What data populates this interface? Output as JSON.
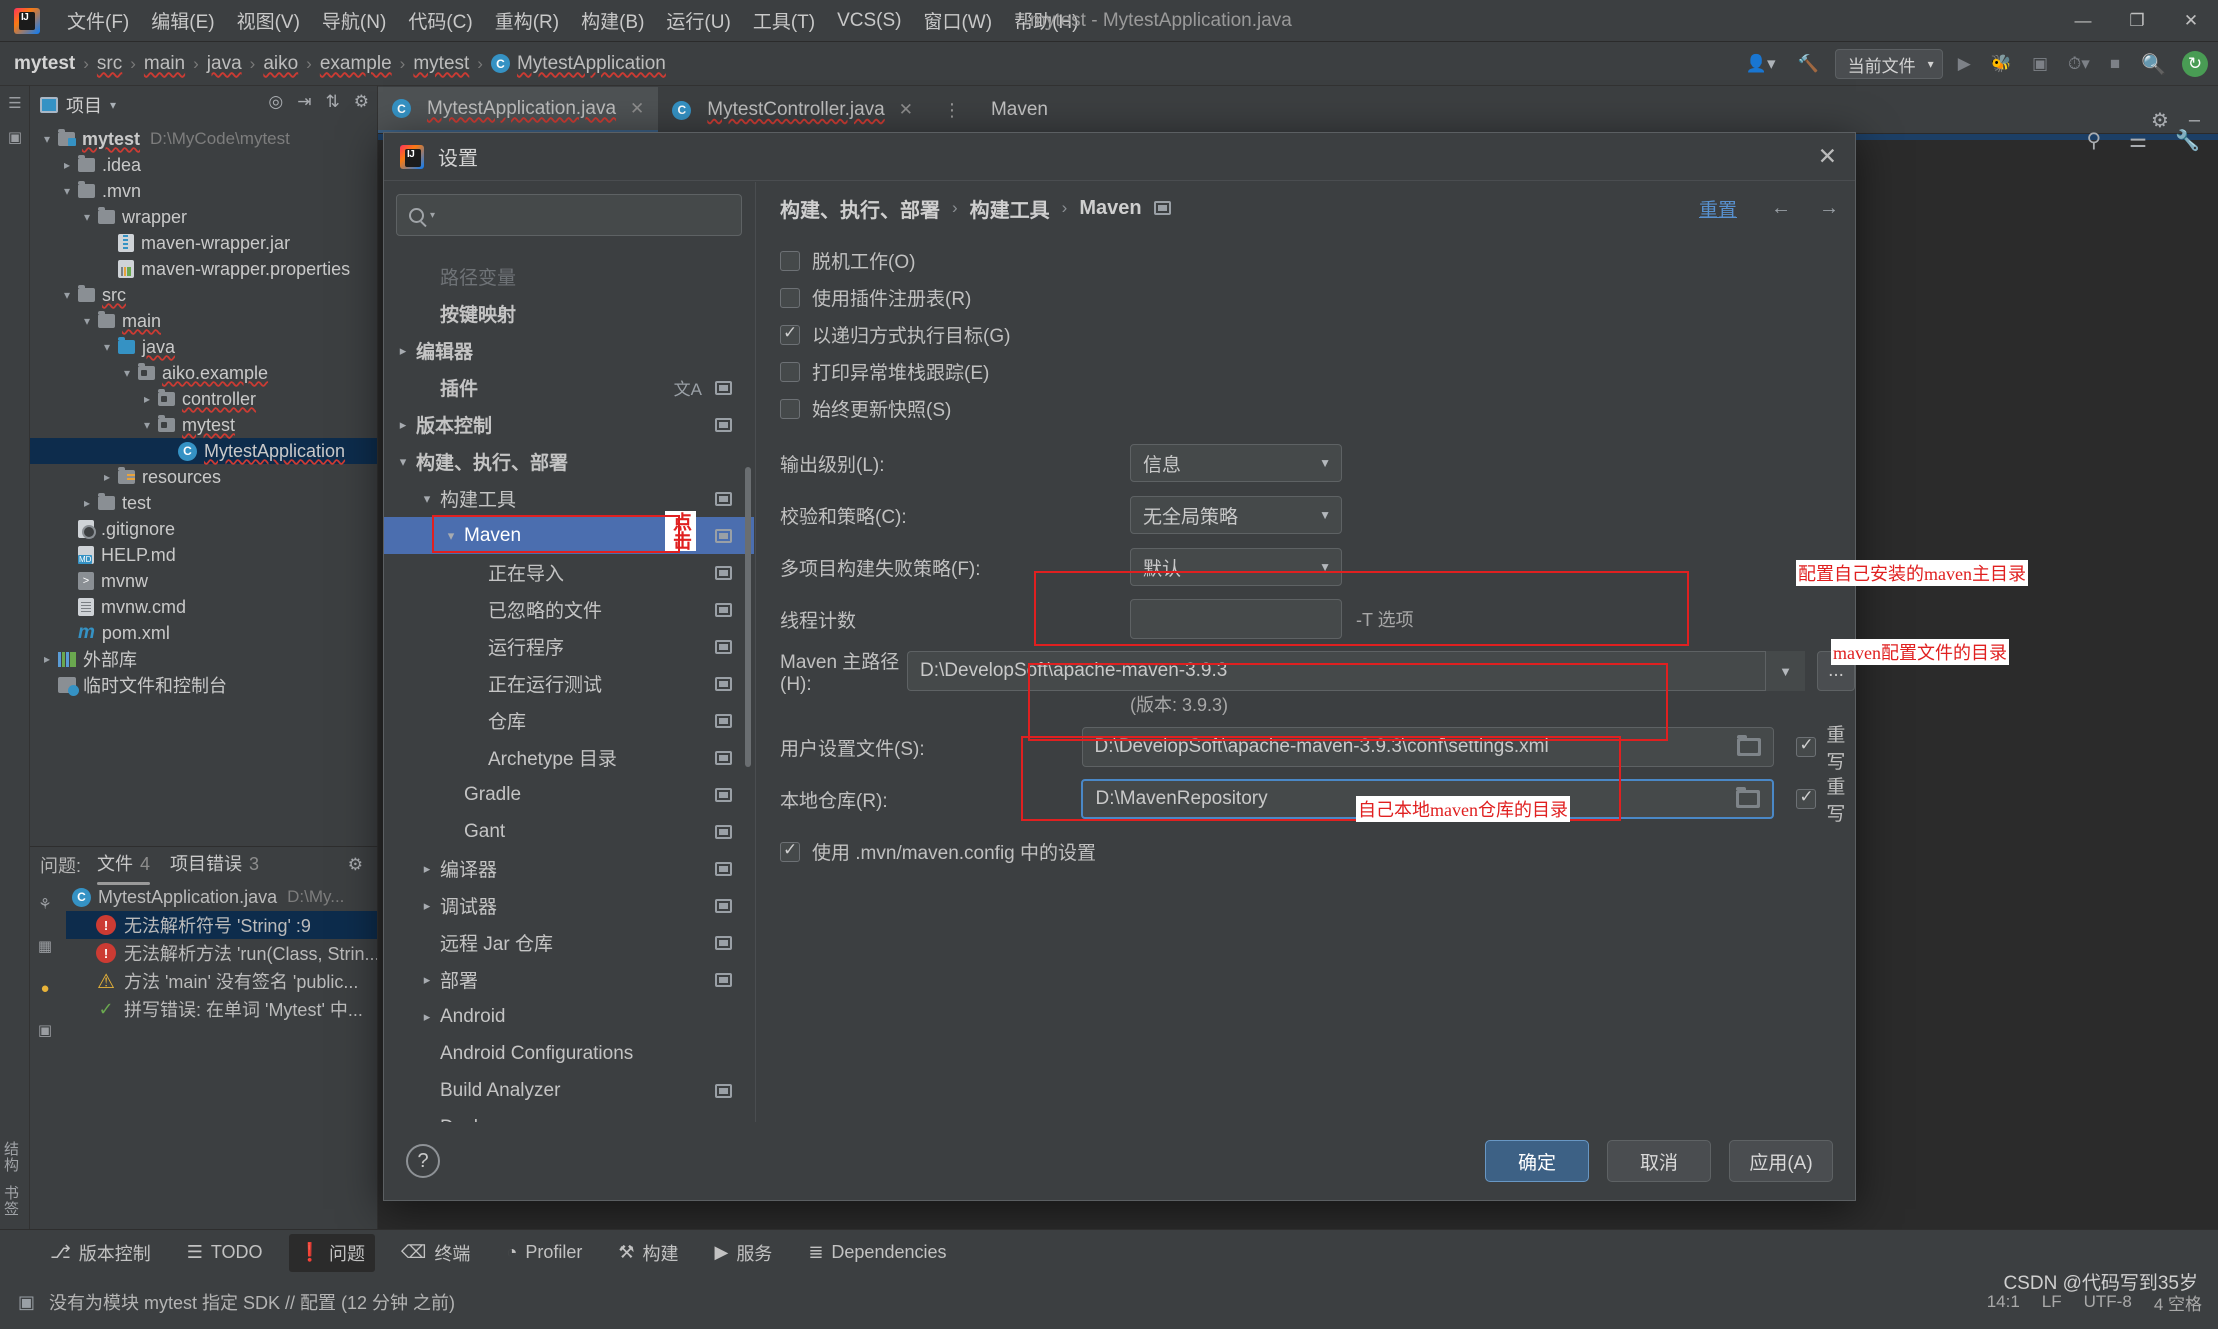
{
  "window": {
    "title": "mytest - MytestApplication.java",
    "menus": [
      "文件(F)",
      "编辑(E)",
      "视图(V)",
      "导航(N)",
      "代码(C)",
      "重构(R)",
      "构建(B)",
      "运行(U)",
      "工具(T)",
      "VCS(S)",
      "窗口(W)",
      "帮助(H)"
    ],
    "controls": {
      "minimize": "—",
      "maximize": "❐",
      "close": "✕"
    }
  },
  "navbar": {
    "crumbs": [
      "mytest",
      "src",
      "main",
      "java",
      "aiko",
      "example",
      "mytest",
      "MytestApplication"
    ],
    "separator": "›",
    "run_config": "当前文件",
    "icons": [
      "user-icon",
      "hammer-icon",
      "run-icon",
      "debug-icon",
      "coverage-icon",
      "profile-icon",
      "stop-icon",
      "search-icon",
      "update-icon"
    ]
  },
  "project_panel": {
    "title": "项目",
    "tools": [
      "collapse-icon",
      "locate-icon",
      "sort-icon",
      "settings-icon"
    ],
    "tree": [
      {
        "depth": 0,
        "arrow": "v",
        "icon": "folder-flag",
        "label": "mytest",
        "bold": true,
        "squig": true,
        "path": "D:\\MyCode\\mytest"
      },
      {
        "depth": 1,
        "arrow": ">",
        "icon": "folder",
        "label": ".idea"
      },
      {
        "depth": 1,
        "arrow": "v",
        "icon": "folder",
        "label": ".mvn"
      },
      {
        "depth": 2,
        "arrow": "v",
        "icon": "folder",
        "label": "wrapper"
      },
      {
        "depth": 3,
        "arrow": "",
        "icon": "zip",
        "label": "maven-wrapper.jar"
      },
      {
        "depth": 3,
        "arrow": "",
        "icon": "prop",
        "label": "maven-wrapper.properties"
      },
      {
        "depth": 1,
        "arrow": "v",
        "icon": "folder",
        "label": "src",
        "squig": true
      },
      {
        "depth": 2,
        "arrow": "v",
        "icon": "folder",
        "label": "main",
        "squig": true
      },
      {
        "depth": 3,
        "arrow": "v",
        "icon": "folder-blue",
        "label": "java",
        "squig": true
      },
      {
        "depth": 4,
        "arrow": "v",
        "icon": "folder-pkg",
        "label": "aiko.example",
        "squig": true
      },
      {
        "depth": 5,
        "arrow": ">",
        "icon": "folder-pkg",
        "label": "controller",
        "squig": true
      },
      {
        "depth": 5,
        "arrow": "v",
        "icon": "folder-pkg",
        "label": "mytest",
        "squig": true
      },
      {
        "depth": 6,
        "arrow": "",
        "icon": "class",
        "label": "MytestApplication",
        "squig": true,
        "selected": true
      },
      {
        "depth": 3,
        "arrow": ">",
        "icon": "folder-res",
        "label": "resources"
      },
      {
        "depth": 2,
        "arrow": ">",
        "icon": "folder",
        "label": "test"
      },
      {
        "depth": 1,
        "arrow": "",
        "icon": "git",
        "label": ".gitignore"
      },
      {
        "depth": 1,
        "arrow": "",
        "icon": "md",
        "label": "HELP.md"
      },
      {
        "depth": 1,
        "arrow": "",
        "icon": "sh",
        "label": "mvnw"
      },
      {
        "depth": 1,
        "arrow": "",
        "icon": "cmd",
        "label": "mvnw.cmd"
      },
      {
        "depth": 1,
        "arrow": "",
        "icon": "maven",
        "label": "pom.xml"
      },
      {
        "depth": 0,
        "arrow": ">",
        "icon": "lib",
        "label": "外部库"
      },
      {
        "depth": 0,
        "arrow": "",
        "icon": "scratch",
        "label": "临时文件和控制台"
      }
    ]
  },
  "problems": {
    "label": "问题:",
    "tabs": [
      {
        "label": "文件",
        "count": "4",
        "active": true
      },
      {
        "label": "项目错误",
        "count": "3",
        "active": false
      }
    ],
    "file": {
      "name": "MytestApplication.java",
      "path": "D:\\My..."
    },
    "rows": [
      {
        "severity": "err",
        "text": "无法解析符号 'String' :9",
        "selected": true
      },
      {
        "severity": "err",
        "text": "无法解析方法 'run(Class, Strin..."
      },
      {
        "severity": "warn",
        "text": "方法 'main' 没有签名 'public..."
      },
      {
        "severity": "ok",
        "text": "拼写错误: 在单词 'Mytest' 中..."
      }
    ],
    "rail_icons": [
      "inspect-icon",
      "grid-icon",
      "bulb-icon",
      "layout-icon"
    ]
  },
  "editor": {
    "tabs": [
      {
        "label": "MytestApplication.java",
        "icon": "class-icon",
        "active": true,
        "close": "✕"
      },
      {
        "label": "MytestController.java",
        "icon": "class-icon",
        "active": false,
        "close": "✕"
      }
    ],
    "tab_menu": "⋮",
    "toolwindow_label": "Maven",
    "right_icons": [
      "settings-icon",
      "minimize-icon"
    ],
    "side_icons": [
      "bookmark-icon",
      "structure-icon",
      "wrench-icon"
    ]
  },
  "dialog": {
    "title": "设置",
    "close": "✕",
    "search_placeholder": "",
    "search_icon": "search-icon",
    "tree": [
      {
        "depth": 1,
        "arrow": "",
        "label": "路径变量",
        "faded": true
      },
      {
        "depth": 1,
        "arrow": "",
        "label": "按键映射",
        "bold": true
      },
      {
        "depth": 0,
        "arrow": ">",
        "label": "编辑器",
        "bold": true
      },
      {
        "depth": 1,
        "arrow": "",
        "label": "插件",
        "bold": true,
        "badge": true,
        "xlate": "文A"
      },
      {
        "depth": 0,
        "arrow": ">",
        "label": "版本控制",
        "bold": true,
        "badge": true
      },
      {
        "depth": 0,
        "arrow": "v",
        "label": "构建、执行、部署",
        "bold": true
      },
      {
        "depth": 1,
        "arrow": "v",
        "label": "构建工具",
        "badge": true
      },
      {
        "depth": 2,
        "arrow": "v",
        "label": "Maven",
        "selected": true,
        "badge": true,
        "annot": "点击"
      },
      {
        "depth": 3,
        "arrow": "",
        "label": "正在导入",
        "badge": true
      },
      {
        "depth": 3,
        "arrow": "",
        "label": "已忽略的文件",
        "badge": true
      },
      {
        "depth": 3,
        "arrow": "",
        "label": "运行程序",
        "badge": true
      },
      {
        "depth": 3,
        "arrow": "",
        "label": "正在运行测试",
        "badge": true
      },
      {
        "depth": 3,
        "arrow": "",
        "label": "仓库",
        "badge": true
      },
      {
        "depth": 3,
        "arrow": "",
        "label": "Archetype 目录",
        "badge": true
      },
      {
        "depth": 2,
        "arrow": "",
        "label": "Gradle",
        "badge": true
      },
      {
        "depth": 2,
        "arrow": "",
        "label": "Gant",
        "badge": true
      },
      {
        "depth": 1,
        "arrow": ">",
        "label": "编译器",
        "badge": true
      },
      {
        "depth": 1,
        "arrow": ">",
        "label": "调试器",
        "badge": true
      },
      {
        "depth": 1,
        "arrow": "",
        "label": "远程 Jar 仓库",
        "badge": true
      },
      {
        "depth": 1,
        "arrow": ">",
        "label": "部署",
        "badge": true
      },
      {
        "depth": 1,
        "arrow": ">",
        "label": "Android"
      },
      {
        "depth": 1,
        "arrow": "",
        "label": "Android Configurations"
      },
      {
        "depth": 1,
        "arrow": "",
        "label": "Build Analyzer",
        "badge": true
      },
      {
        "depth": 1,
        "arrow": ">",
        "label": "Docker"
      }
    ],
    "content": {
      "breadcrumb": [
        "构建、执行、部署",
        "构建工具",
        "Maven"
      ],
      "breadcrumb_sep": "›",
      "reset_label": "重置",
      "nav_back": "←",
      "nav_forward": "→",
      "checkboxes": [
        {
          "label": "脱机工作(O)",
          "checked": false,
          "mnemonic": "O"
        },
        {
          "label": "使用插件注册表(R)",
          "checked": false,
          "mnemonic": "R"
        },
        {
          "label": "以递归方式执行目标(G)",
          "checked": true,
          "mnemonic": "G"
        },
        {
          "label": "打印异常堆栈跟踪(E)",
          "checked": false,
          "mnemonic": "E"
        },
        {
          "label": "始终更新快照(S)",
          "checked": false,
          "mnemonic": "S"
        }
      ],
      "selects": [
        {
          "label": "输出级别(L):",
          "value": "信息"
        },
        {
          "label": "校验和策略(C):",
          "value": "无全局策略"
        },
        {
          "label": "多项目构建失败策略(F):",
          "value": "默认"
        }
      ],
      "thread_count": {
        "label": "线程计数",
        "value": "",
        "hint": "-T 选项"
      },
      "maven_home": {
        "label": "Maven 主路径(H):",
        "value": "D:\\DevelopSoft\\apache-maven-3.9.3",
        "dots": "...",
        "version": "(版本: 3.9.3)"
      },
      "user_settings": {
        "label": "用户设置文件(S):",
        "value": "D:\\DevelopSoft\\apache-maven-3.9.3\\conf\\settings.xml",
        "override_label": "重写",
        "override_checked": true
      },
      "local_repo": {
        "label": "本地仓库(R):",
        "value": "D:\\MavenRepository",
        "override_label": "重写",
        "override_checked": true
      },
      "mvn_config": {
        "label": "使用 .mvn/maven.config 中的设置",
        "checked": true
      },
      "annotations": [
        {
          "text": "配置自己安装的maven主目录"
        },
        {
          "text": "maven配置文件的目录"
        },
        {
          "text": "自己本地maven仓库的目录"
        }
      ]
    },
    "footer": {
      "help": "?",
      "ok": "确定",
      "cancel": "取消",
      "apply": "应用(A)"
    }
  },
  "bottombar": {
    "items": [
      {
        "label": "版本控制",
        "icon": "branch-icon"
      },
      {
        "label": "TODO",
        "icon": "list-icon"
      },
      {
        "label": "问题",
        "icon": "error-icon",
        "active": true
      },
      {
        "label": "终端",
        "icon": "terminal-icon"
      },
      {
        "label": "Profiler",
        "icon": "profiler-icon"
      },
      {
        "label": "构建",
        "icon": "hammer-icon"
      },
      {
        "label": "服务",
        "icon": "play-icon"
      },
      {
        "label": "Dependencies",
        "icon": "layers-icon"
      }
    ]
  },
  "statusbar": {
    "message": "没有为模块 mytest 指定 SDK // 配置  (12 分钟 之前)",
    "icon": "module-icon",
    "right": [
      "14:1",
      "LF",
      "UTF-8",
      "4 空格"
    ],
    "watermark": "CSDN @代码写到35岁"
  }
}
